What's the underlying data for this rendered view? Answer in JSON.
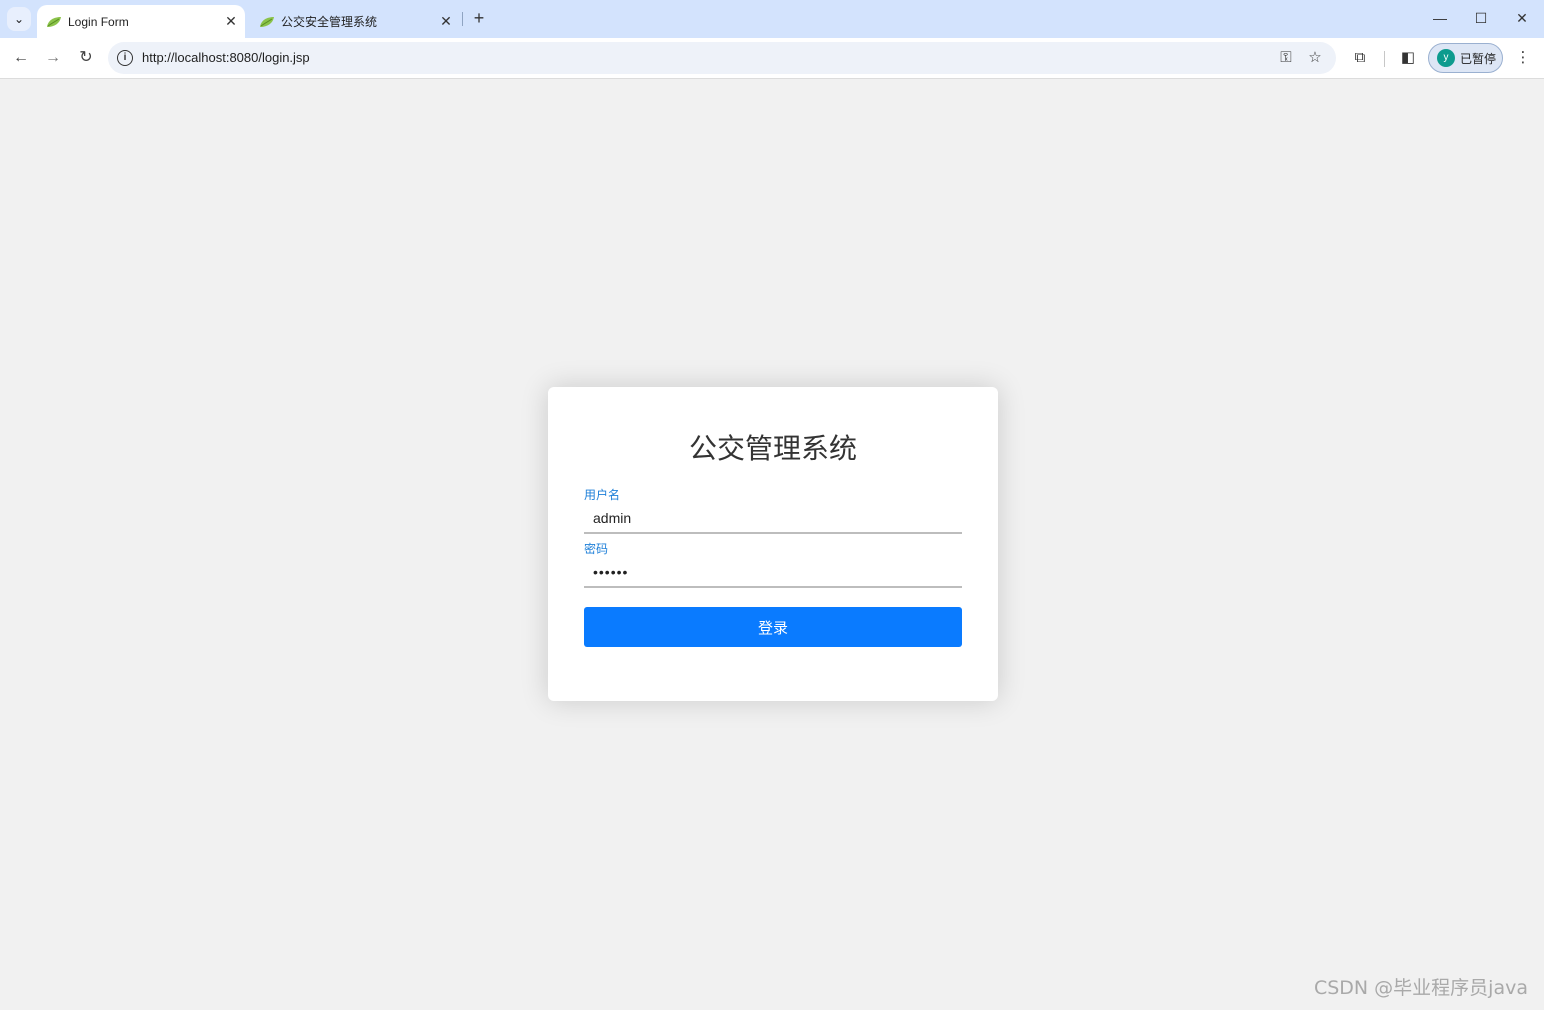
{
  "browser": {
    "tabs": [
      {
        "title": "Login Form",
        "active": true
      },
      {
        "title": "公交安全管理系统",
        "active": false
      }
    ],
    "icons": {
      "tab_search": "⌄",
      "close": "✕",
      "new_tab": "+",
      "minimize": "—",
      "maximize": "☐",
      "window_close": "✕",
      "back": "←",
      "forward": "→",
      "reload": "↻",
      "info": "i",
      "key": "⚿",
      "bookmark": "☆",
      "extensions": "⧉",
      "side_panel": "◧",
      "menu": "⋮"
    },
    "url": "http://localhost:8080/login.jsp",
    "profile": {
      "initial": "y",
      "label": "已暂停"
    }
  },
  "login": {
    "title": "公交管理系统",
    "username_label": "用户名",
    "username_value": "admin",
    "password_label": "密码",
    "password_value": "••••••",
    "submit_label": "登录"
  },
  "watermark": "CSDN @毕业程序员java",
  "colors": {
    "accent": "#0a7bff",
    "label": "#1e7fd8",
    "tabstrip": "#d3e3fd"
  }
}
